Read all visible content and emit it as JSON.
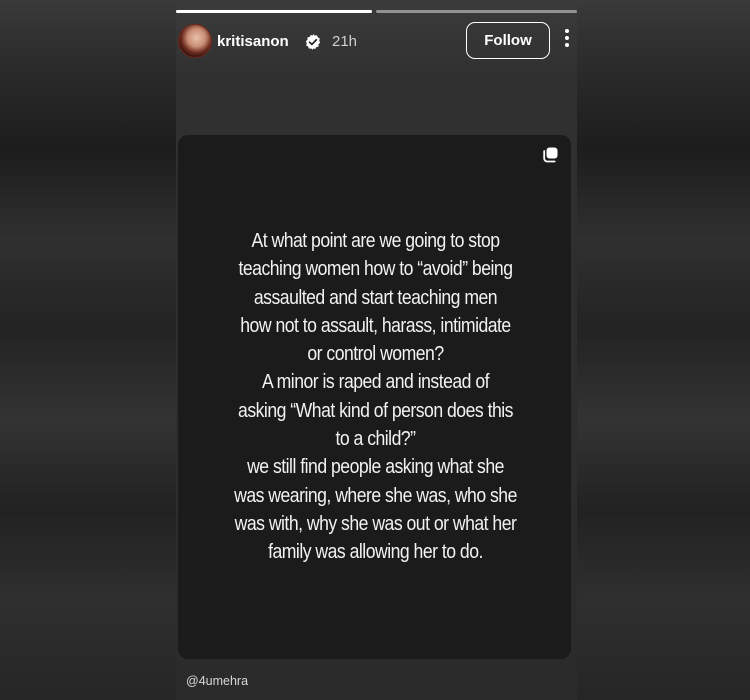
{
  "story": {
    "progress": [
      {
        "value": 1.0
      },
      {
        "value": 0.0
      }
    ],
    "header": {
      "username": "kritisanon",
      "verified_icon": "verified-badge-icon",
      "time": "21h",
      "follow_label": "Follow",
      "more_icon": "more-vertical-icon"
    },
    "card": {
      "copy_icon": "copy-icon",
      "lines": [
        "At what point are we going to stop",
        "teaching women how to “avoid” being",
        "assaulted and start teaching men",
        "how not to assault, harass, intimidate",
        "or control women?",
        "A minor is raped and instead of",
        "asking “What kind of person does this",
        "to a child?”",
        "we still find people asking what she",
        "was wearing, where she was, who she",
        "was with, why she was out or what her",
        "family was allowing her to do."
      ]
    }
  },
  "credit": "@4umehra",
  "colors": {
    "card_bg": "#1b1b1b",
    "text": "#f2f2f2",
    "follow_border": "#ffffff"
  }
}
